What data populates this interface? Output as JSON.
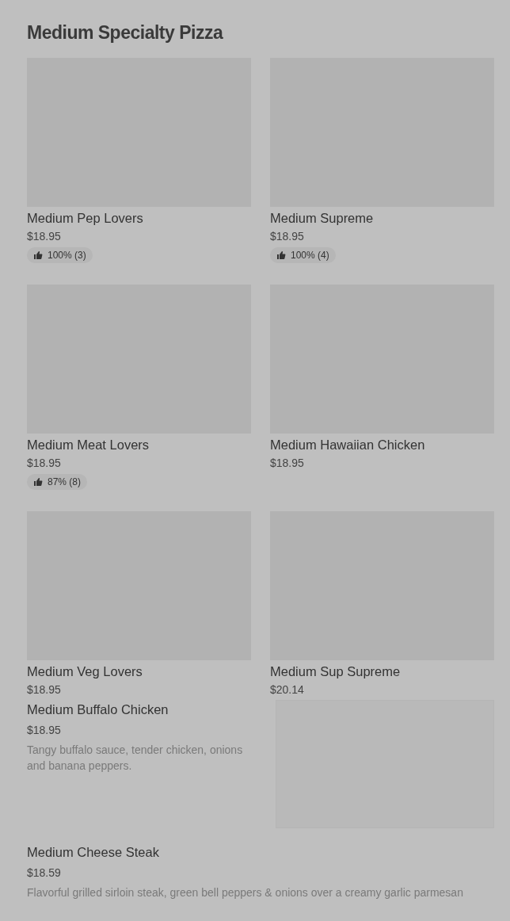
{
  "section": {
    "title": "Medium Specialty Pizza"
  },
  "grid_items": [
    {
      "name": "Medium Pep Lovers",
      "price": "$18.95",
      "rating": "100% (3)"
    },
    {
      "name": "Medium Supreme",
      "price": "$18.95",
      "rating": "100% (4)"
    },
    {
      "name": "Medium Meat Lovers",
      "price": "$18.95",
      "rating": "87% (8)"
    },
    {
      "name": "Medium Hawaiian Chicken",
      "price": "$18.95"
    },
    {
      "name": "Medium Veg Lovers",
      "price": "$18.95"
    },
    {
      "name": "Medium Sup Supreme",
      "price": "$20.14"
    }
  ],
  "list_items": [
    {
      "name": "Medium Buffalo Chicken",
      "price": "$18.95",
      "description": "Tangy buffalo sauce, tender chicken, onions and banana peppers.",
      "image": true
    },
    {
      "name": "Medium Cheese Steak",
      "price": "$18.59",
      "description": "Flavorful grilled sirloin steak, green bell peppers & onions over a creamy garlic parmesan",
      "image": false
    }
  ]
}
